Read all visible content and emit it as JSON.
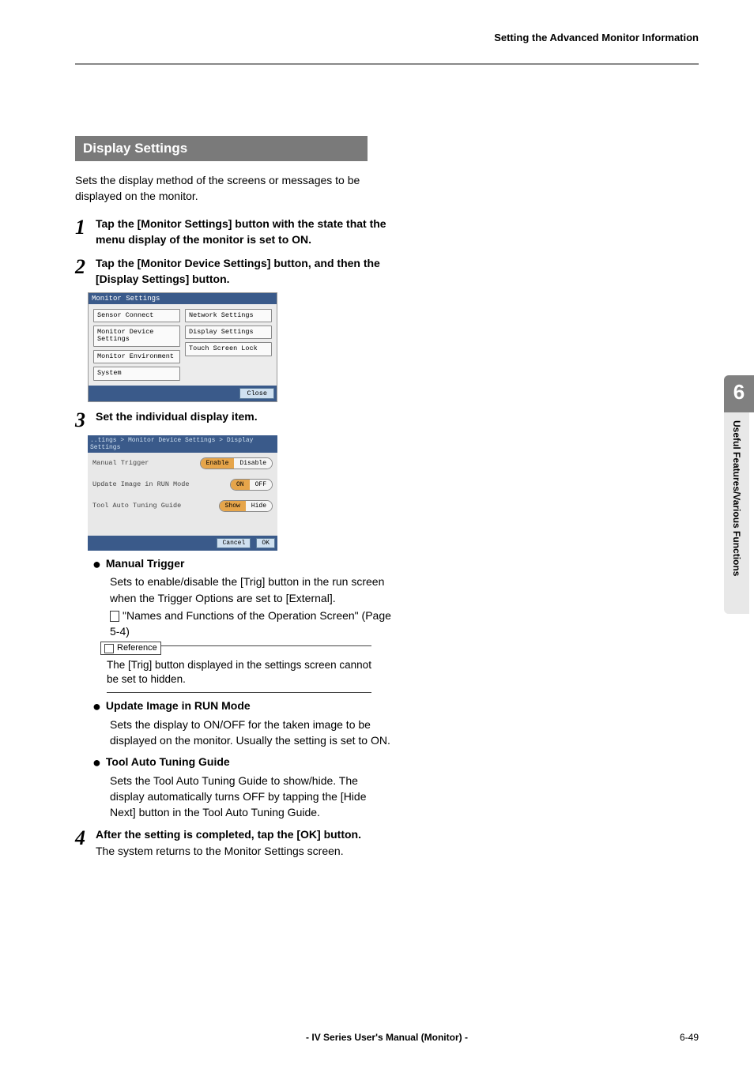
{
  "header": {
    "right_title": "Setting the Advanced Monitor Information"
  },
  "section": {
    "banner": "Display Settings",
    "intro": "Sets the display method of the screens or messages to be displayed on the monitor."
  },
  "steps": {
    "s1": {
      "num": "1",
      "head": "Tap the [Monitor Settings] button with the state that the menu display of the monitor is set to ON."
    },
    "s2": {
      "num": "2",
      "head": "Tap the [Monitor Device Settings] button, and then the [Display Settings] button."
    },
    "s3": {
      "num": "3",
      "head": "Set the individual display item."
    },
    "s4": {
      "num": "4",
      "head": "After the setting is completed, tap the [OK] button.",
      "body": "The system returns to the Monitor Settings screen."
    }
  },
  "ui1": {
    "title": "Monitor Settings",
    "left": {
      "b1": "Sensor Connect",
      "b2": "Monitor Device Settings",
      "b3": "Monitor Environment",
      "b4": "System"
    },
    "right": {
      "b1": "Network Settings",
      "b2": "Display Settings",
      "b3": "Touch Screen Lock"
    },
    "close": "Close"
  },
  "ui2": {
    "crumb": "..tings > Monitor Device Settings > Display Settings",
    "r1": {
      "label": "Manual Trigger",
      "on": "Enable",
      "off": "Disable"
    },
    "r2": {
      "label": "Update Image in RUN Mode",
      "on": "ON",
      "off": "OFF"
    },
    "r3": {
      "label": "Tool Auto Tuning Guide",
      "on": "Show",
      "off": "Hide"
    },
    "cancel": "Cancel",
    "ok": "OK"
  },
  "items": {
    "manual_trigger": {
      "title": "Manual Trigger",
      "body": "Sets to enable/disable the [Trig] button in the run screen when the Trigger Options are set to [External].",
      "xref": "\"Names and Functions of the Operation Screen\" (Page 5-4)",
      "ref_label": "Reference",
      "ref_text": "The [Trig] button displayed in the settings screen cannot be set to hidden."
    },
    "update_image": {
      "title": "Update Image in RUN Mode",
      "body": "Sets the display to ON/OFF for the taken image to be displayed on the monitor. Usually the setting is set to ON."
    },
    "tool_auto": {
      "title": "Tool Auto Tuning Guide",
      "body": "Sets the Tool Auto Tuning Guide to show/hide. The display automatically turns OFF by tapping the [Hide Next] button in the Tool Auto Tuning Guide."
    }
  },
  "sidetab": {
    "num": "6",
    "text": "Useful Features/Various Functions"
  },
  "footer": {
    "center": "- IV Series User's Manual (Monitor) -",
    "page": "6-49"
  }
}
